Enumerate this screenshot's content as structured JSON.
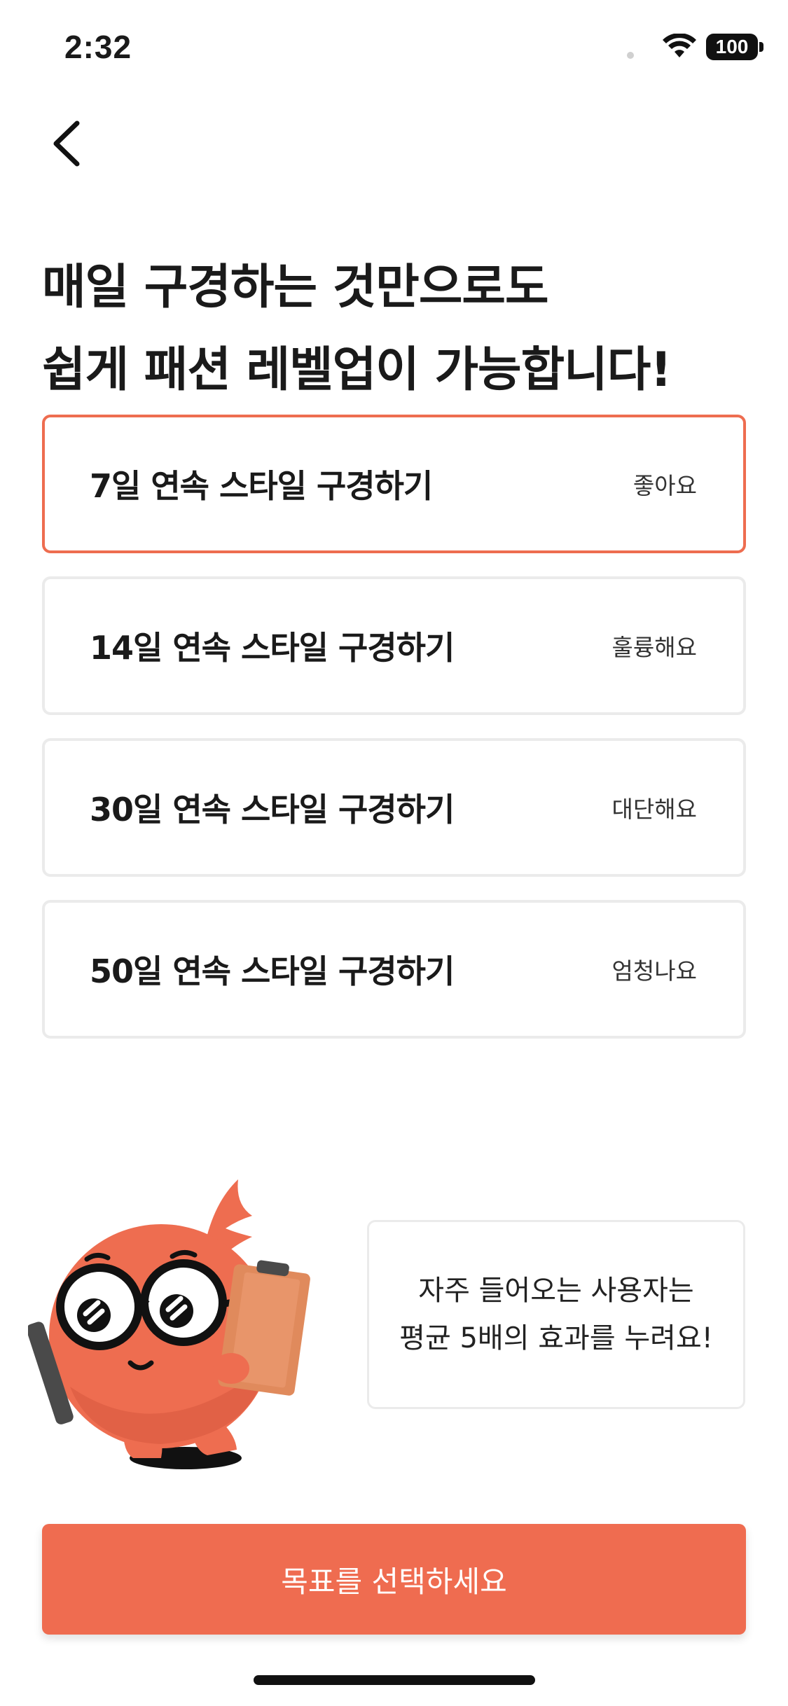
{
  "status_bar": {
    "time": "2:32",
    "battery": "100"
  },
  "headline": {
    "line1": "매일 구경하는 것만으로도",
    "line2": "쉽게 패션 레벨업이 가능합니다!"
  },
  "options": [
    {
      "title": "7일 연속 스타일 구경하기",
      "tag": "좋아요",
      "selected": true
    },
    {
      "title": "14일 연속 스타일 구경하기",
      "tag": "훌륭해요",
      "selected": false
    },
    {
      "title": "30일 연속 스타일 구경하기",
      "tag": "대단해요",
      "selected": false
    },
    {
      "title": "50일 연속 스타일 구경하기",
      "tag": "엄청나요",
      "selected": false
    }
  ],
  "tip": {
    "line1": "자주 들어오는 사용자는",
    "line2": "평균 5배의 효과를 누려요!"
  },
  "cta": {
    "label": "목표를 선택하세요"
  },
  "colors": {
    "accent": "#ef6c50",
    "selected_border": "#ee6d50",
    "card_border": "#ebebeb"
  }
}
